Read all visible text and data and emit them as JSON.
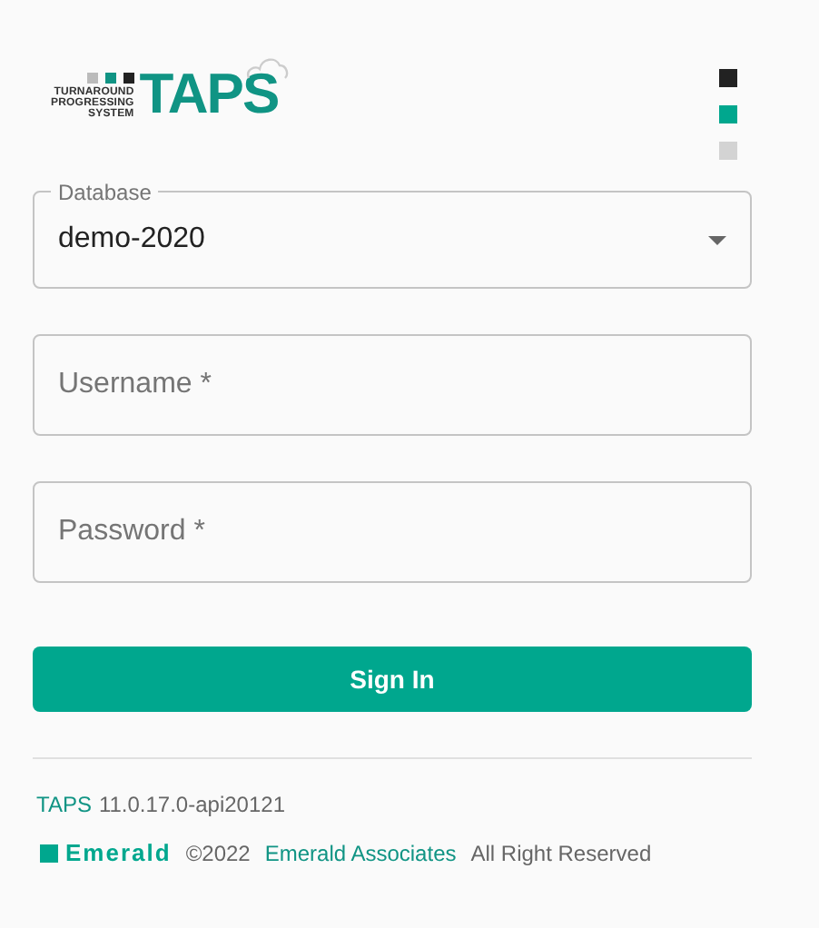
{
  "logo": {
    "tagline_lines": [
      "TURNAROUND",
      "PROGRESSING",
      "SYSTEM"
    ],
    "wordmark": "TAPS"
  },
  "database": {
    "label": "Database",
    "value": "demo-2020"
  },
  "username": {
    "placeholder": "Username *"
  },
  "password": {
    "placeholder": "Password *"
  },
  "sign_in_button": "Sign In",
  "version": {
    "product": "TAPS",
    "number": "11.0.17.0-api20121"
  },
  "footer": {
    "brand": "Emerald",
    "copyright": "©2022",
    "company_link": "Emerald Associates",
    "rights": "All Right Reserved"
  }
}
